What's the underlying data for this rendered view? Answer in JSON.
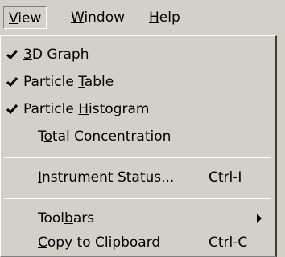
{
  "menubar": {
    "view": {
      "pre": "",
      "mn": "V",
      "post": "iew"
    },
    "window": {
      "pre": "",
      "mn": "W",
      "post": "indow"
    },
    "help": {
      "pre": "",
      "mn": "H",
      "post": "elp"
    }
  },
  "menu": {
    "graph3d": {
      "pre": "",
      "mn": "3",
      "post": "D Graph",
      "checked": true
    },
    "particle_table": {
      "pre": "Particle ",
      "mn": "T",
      "post": "able",
      "checked": true
    },
    "particle_histogram": {
      "pre": "Particle ",
      "mn": "H",
      "post": "istogram",
      "checked": true
    },
    "total_concentration": {
      "pre": "T",
      "mn": "o",
      "post": "tal Concentration",
      "checked": false
    },
    "instrument_status": {
      "pre": "",
      "mn": "I",
      "post": "nstrument Status...",
      "shortcut": "Ctrl-I"
    },
    "toolbars": {
      "pre": "Tool",
      "mn": "b",
      "post": "ars"
    },
    "copy_clipboard": {
      "pre": "",
      "mn": "C",
      "post": "opy to Clipboard",
      "shortcut": "Ctrl-C"
    }
  },
  "icons": {
    "check": "checkmark-icon",
    "submenu": "submenu-arrow-icon"
  }
}
